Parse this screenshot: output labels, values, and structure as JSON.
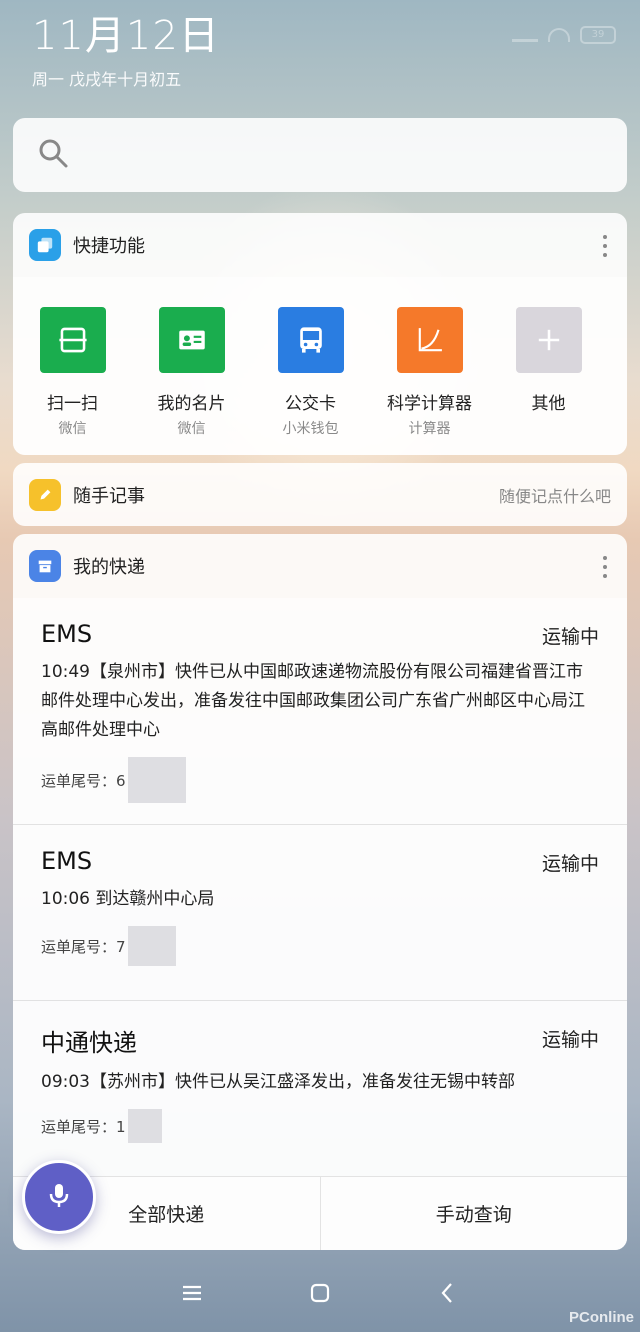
{
  "status_bar": {
    "date": "11月12日",
    "subdate": "周一 戊戌年十月初五",
    "battery": "39"
  },
  "search": {
    "icon": "search-icon"
  },
  "quick_functions": {
    "title": "快捷功能",
    "items": [
      {
        "label": "扫一扫",
        "sub": "微信",
        "icon": "scan-icon",
        "color": "#1aad4e"
      },
      {
        "label": "我的名片",
        "sub": "微信",
        "icon": "business-card-icon",
        "color": "#1aad4e"
      },
      {
        "label": "公交卡",
        "sub": "小米钱包",
        "icon": "bus-icon",
        "color": "#2a7de1"
      },
      {
        "label": "科学计算器",
        "sub": "计算器",
        "icon": "chart-curve-icon",
        "color": "#f5792a"
      },
      {
        "label": "其他",
        "sub": "",
        "icon": "plus-icon",
        "color": "#d9d6dc"
      }
    ]
  },
  "memo": {
    "title": "随手记事",
    "hint": "随便记点什么吧"
  },
  "express": {
    "title": "我的快递",
    "packages": [
      {
        "company": "EMS",
        "status": "运输中",
        "detail": "10:49【泉州市】快件已从中国邮政速递物流股份有限公司福建省晋江市邮件处理中心发出，准备发往中国邮政集团公司广东省广州邮区中心局江高邮件处理中心",
        "id_label": "运单尾号：6"
      },
      {
        "company": "EMS",
        "status": "运输中",
        "detail": "10:06 到达赣州中心局",
        "id_label": "运单尾号：7"
      },
      {
        "company": "中通快递",
        "status": "运输中",
        "detail": "09:03【苏州市】快件已从吴江盛泽发出，准备发往无锡中转部",
        "id_label": "运单尾号：1"
      }
    ],
    "all_button": "全部快递",
    "manual_button": "手动查询"
  },
  "watermark": "PConline"
}
